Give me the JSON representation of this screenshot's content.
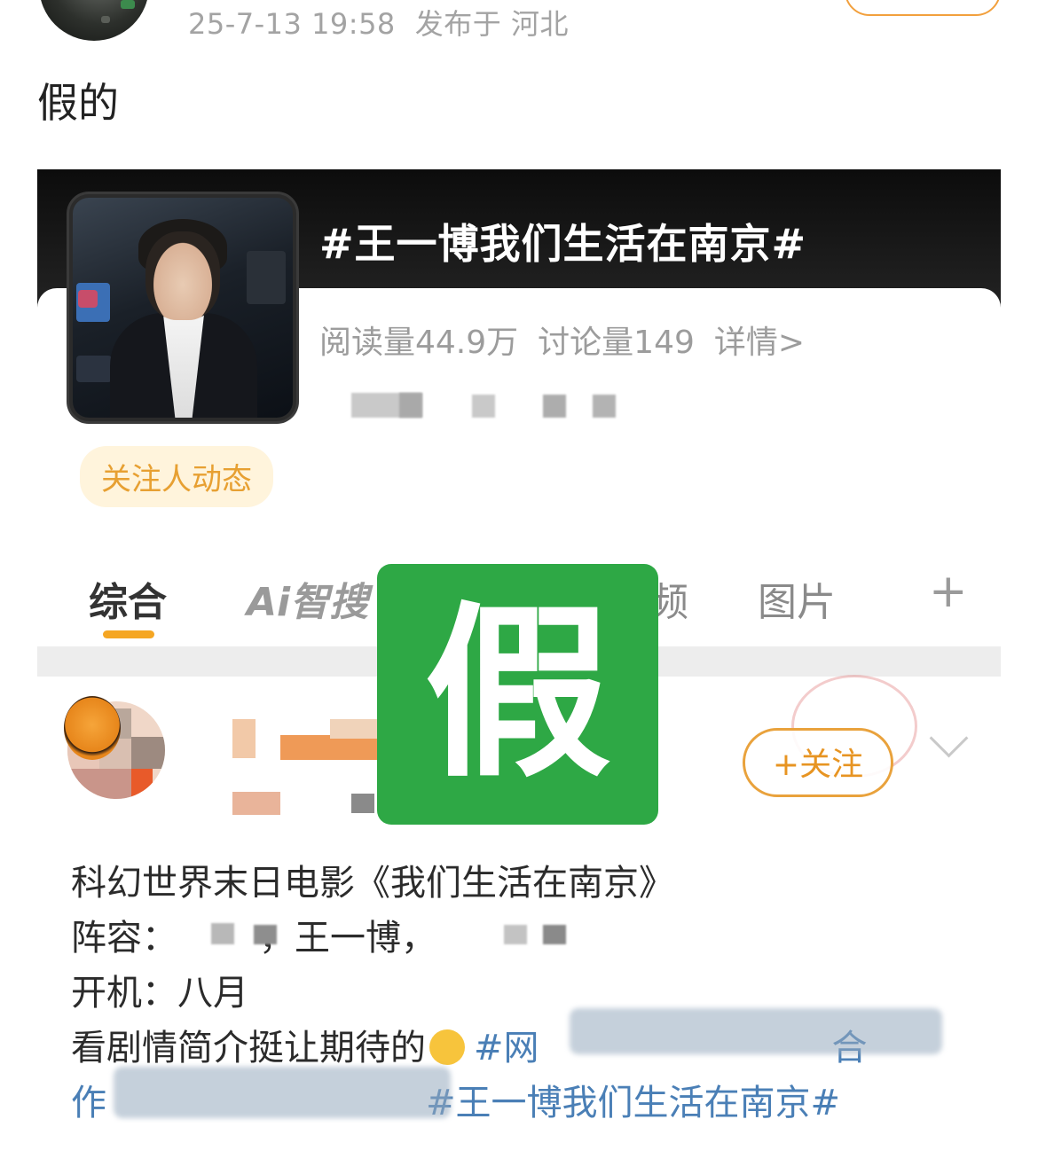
{
  "post": {
    "meta": "25-7-13 19:58",
    "location": "发布于 河北",
    "text": "假的"
  },
  "screenshot": {
    "topic_title": "#王一博我们生活在南京#",
    "reads": "阅读量44.9万",
    "discussions": "讨论量149",
    "details_link": "详情>",
    "follow_dynamic": "关注人动态",
    "tabs": [
      {
        "label": "综合",
        "active": true
      },
      {
        "label": "Ai智搜",
        "active": false
      },
      {
        "label": "频",
        "active": false
      },
      {
        "label": "图片",
        "active": false
      }
    ],
    "tab_add_icon": "plus-icon",
    "feed_follow_button": "+关注",
    "feed_lines": [
      "科幻世界末日电影《我们生活在南京》",
      "阵容：",
      "，王一博，",
      "开机：八月",
      "看剧情简介挺让期待的",
      "#网",
      "合",
      "作",
      "#王一博我们生活在南京#"
    ]
  },
  "overlay": {
    "stamp_text": "假",
    "stamp_color": "#2ea845"
  },
  "colors": {
    "accent": "#f5a623",
    "hashtag": "#4a7fb6",
    "meta_gray": "#a3a3a3"
  }
}
